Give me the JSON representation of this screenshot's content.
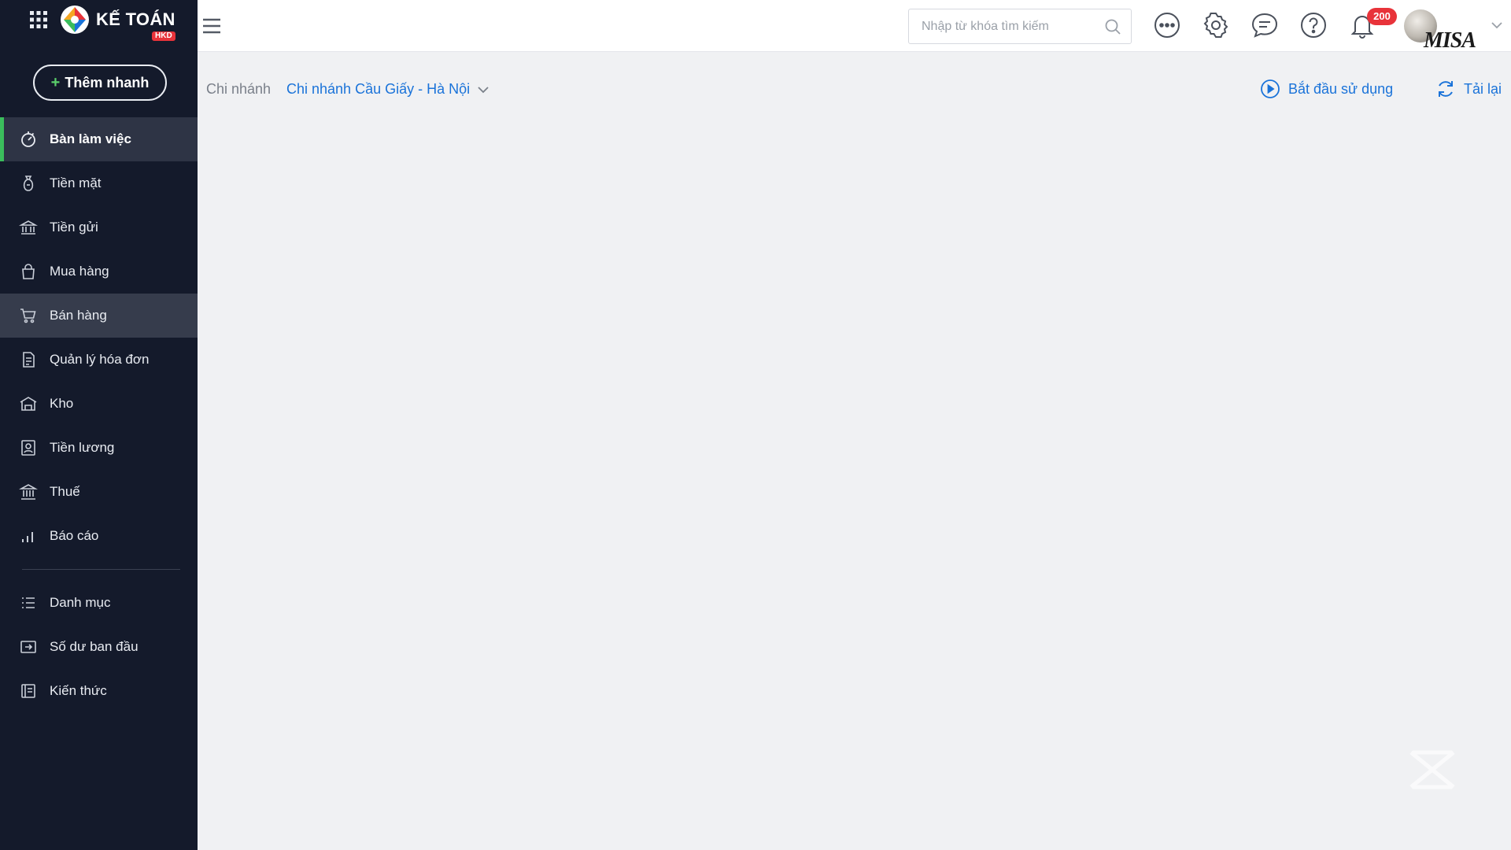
{
  "app": {
    "logo_title": "KẾ TOÁN",
    "logo_badge": "HKD",
    "accent_color": "#3bbd5c",
    "link_color": "#1a73d9"
  },
  "sidebar": {
    "quick_add_label": "Thêm nhanh",
    "items": [
      {
        "label": "Bàn làm việc",
        "icon": "dashboard-icon",
        "active": true
      },
      {
        "label": "Tiền mặt",
        "icon": "money-bag-icon"
      },
      {
        "label": "Tiền gửi",
        "icon": "bank-icon"
      },
      {
        "label": "Mua hàng",
        "icon": "shopping-bag-icon"
      },
      {
        "label": "Bán hàng",
        "icon": "cart-icon",
        "hover": true
      },
      {
        "label": "Quản lý hóa đơn",
        "icon": "invoice-icon"
      },
      {
        "label": "Kho",
        "icon": "warehouse-icon"
      },
      {
        "label": "Tiền lương",
        "icon": "payroll-icon"
      },
      {
        "label": "Thuế",
        "icon": "tax-icon"
      },
      {
        "label": "Báo cáo",
        "icon": "report-icon"
      },
      {
        "label": "Danh mục",
        "icon": "list-icon"
      },
      {
        "label": "Số dư ban đầu",
        "icon": "opening-balance-icon"
      },
      {
        "label": "Kiến thức",
        "icon": "knowledge-icon"
      }
    ]
  },
  "topbar": {
    "search_placeholder": "Nhập từ khóa tìm kiếm",
    "notification_count": "200",
    "brand_mark": "MISA"
  },
  "subheader": {
    "branch_label": "Chi nhánh",
    "branch_value": "Chi nhánh Cầu Giấy - Hà Nội",
    "start_label": "Bắt đầu sử dụng",
    "reload_label": "Tải lại"
  }
}
